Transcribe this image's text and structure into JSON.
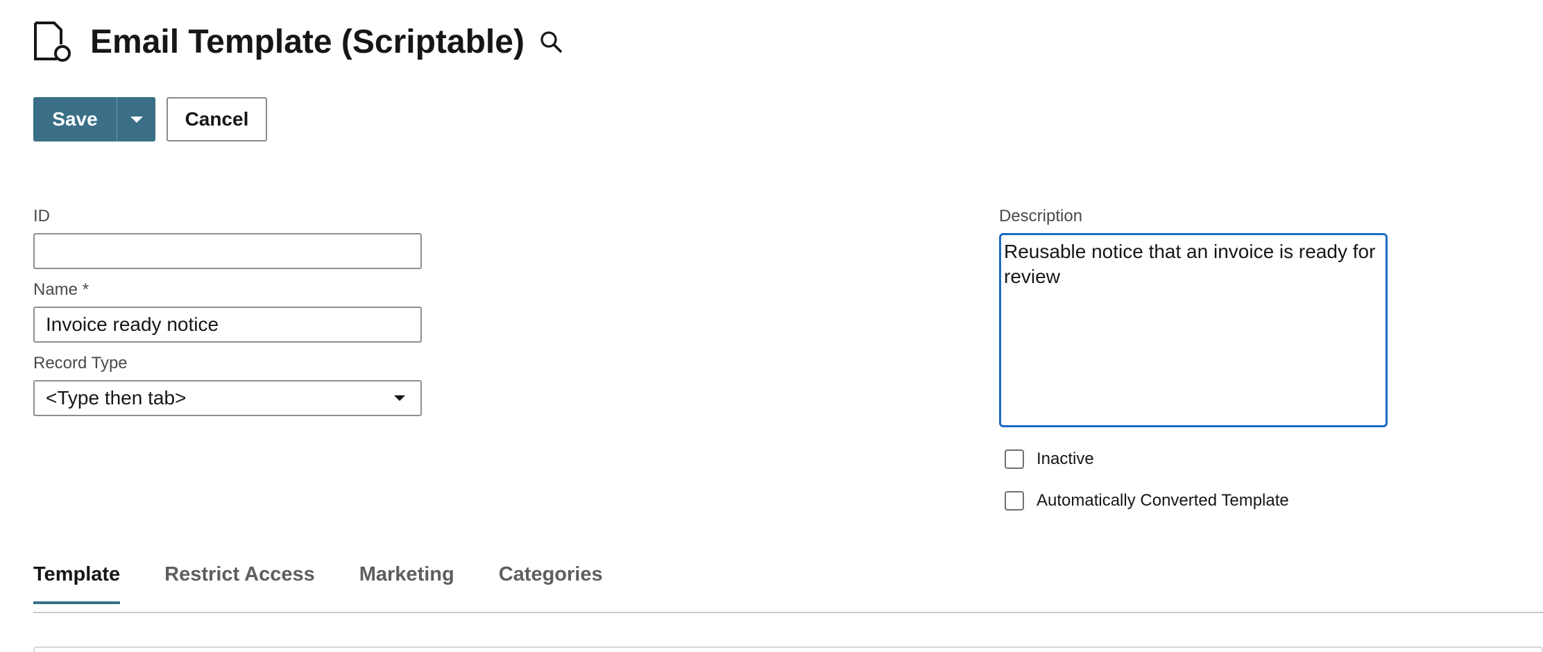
{
  "header": {
    "title": "Email Template (Scriptable)",
    "record_icon": "document-icon",
    "search_icon": "search-icon"
  },
  "toolbar": {
    "save_label": "Save",
    "cancel_label": "Cancel",
    "accent_color": "#3a6f87"
  },
  "form": {
    "id": {
      "label": "ID",
      "value": ""
    },
    "name": {
      "label": "Name *",
      "value": "Invoice ready notice"
    },
    "record_type": {
      "label": "Record Type",
      "value": "<Type then tab>"
    },
    "description": {
      "label": "Description",
      "value": "Reusable notice that an invoice is ready for review"
    },
    "inactive": {
      "label": "Inactive",
      "checked": false
    },
    "auto_converted": {
      "label": "Automatically Converted Template",
      "checked": false
    }
  },
  "tabs": [
    {
      "label": "Template",
      "active": true
    },
    {
      "label": "Restrict Access",
      "active": false
    },
    {
      "label": "Marketing",
      "active": false
    },
    {
      "label": "Categories",
      "active": false
    }
  ]
}
